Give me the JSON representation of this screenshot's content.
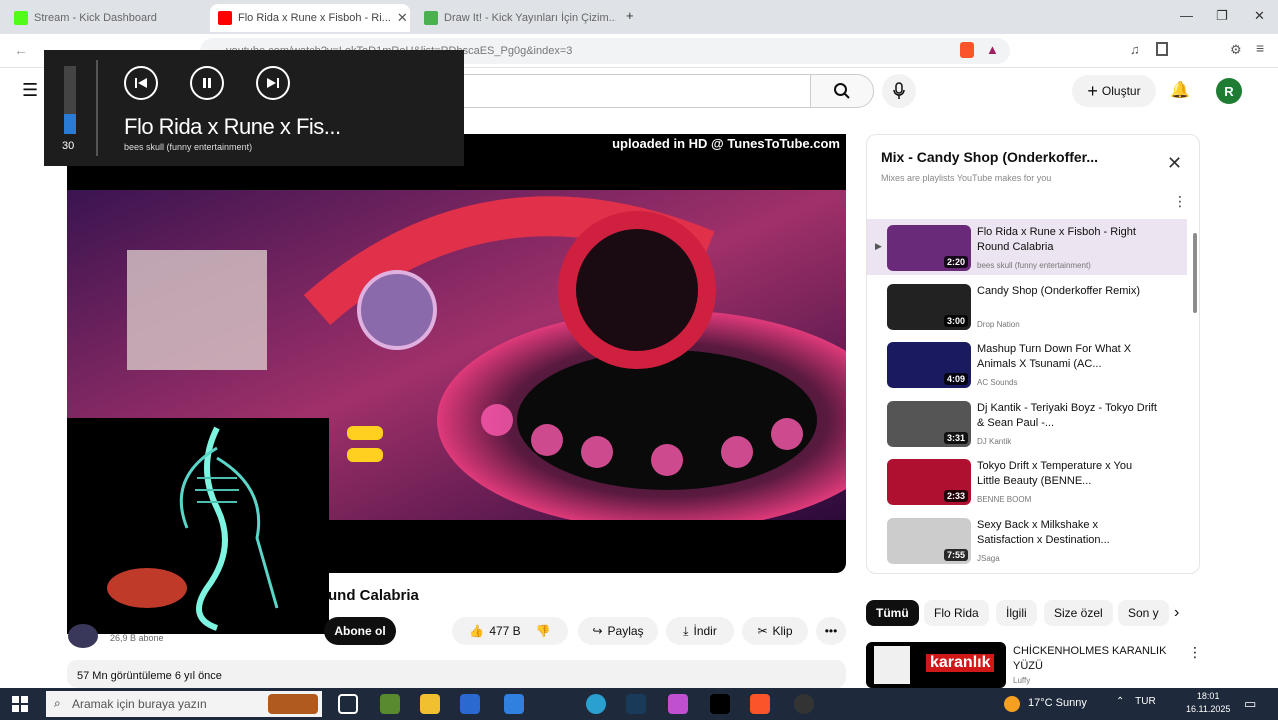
{
  "browser": {
    "tabs": [
      {
        "label": "Stream - Kick Dashboard",
        "active": false,
        "favicon_color": "#53fc18"
      },
      {
        "label": "Flo Rida x Rune x Fisboh - Ri...",
        "active": true,
        "favicon_color": "#ff0000"
      },
      {
        "label": "Draw It! - Kick Yayınları İçin Çizim...",
        "active": false,
        "favicon_color": "#4caf50"
      }
    ],
    "new_tab": "+",
    "url": "youtube.com/watch?v=LokToD1mRoU&list=RDhscaES_Pg0g&index=3",
    "window_controls": [
      "—",
      "❐",
      "✕"
    ]
  },
  "media_overlay": {
    "volume": "30",
    "volume_fraction": 0.3,
    "title": "Flo Rida x  Rune x Fis...",
    "artist": "bees skull (funny entertainment)"
  },
  "youtube": {
    "header": {
      "create_label": "Oluştur",
      "avatar_letter": "R"
    },
    "video": {
      "overlay_text": "uploaded in HD @ TunesToTube.com",
      "title_visible": "und Calabria",
      "subscribers": "26,9 B abone",
      "subscribe_label": "Abone ol",
      "likes": "477 B",
      "share_label": "Paylaş",
      "download_label": "İndir",
      "clip_label": "Klip",
      "views_date": "57 Mn görüntüleme  6 yıl önce"
    },
    "playlist": {
      "title": "Mix - Candy Shop (Onderkoffer...",
      "subtitle": "Mixes are playlists YouTube makes for you",
      "items": [
        {
          "title": "Flo Rida x Rune x Fisboh - Right Round Calabria",
          "channel": "bees skull (funny entertainment)",
          "duration": "2:20",
          "current": true,
          "thumb": "#6a2a7a"
        },
        {
          "title": "Candy Shop (Onderkoffer Remix)",
          "channel": "Drop Nation",
          "duration": "3:00",
          "current": false,
          "thumb": "#222222"
        },
        {
          "title": "Mashup Turn Down For What X Animals X Tsunami (AC...",
          "channel": "AC Sounds",
          "duration": "4:09",
          "current": false,
          "thumb": "#1a1a60"
        },
        {
          "title": "Dj Kantik - Teriyaki Boyz - Tokyo Drift & Sean Paul -...",
          "channel": "DJ Kantik",
          "duration": "3:31",
          "current": false,
          "thumb": "#555555"
        },
        {
          "title": "Tokyo Drift x Temperature x You Little Beauty (BENNE...",
          "channel": "BENNE BOOM",
          "duration": "2:33",
          "current": false,
          "thumb": "#b01030"
        },
        {
          "title": "Sexy Back x Milkshake x Satisfaction x Destination...",
          "channel": "JSaga",
          "duration": "7:55",
          "current": false,
          "thumb": "#cccccc"
        }
      ]
    },
    "chips": [
      {
        "label": "Tümü",
        "selected": true
      },
      {
        "label": "Flo Rida",
        "selected": false
      },
      {
        "label": "İlgili",
        "selected": false
      },
      {
        "label": "Size özel",
        "selected": false
      },
      {
        "label": "Son y",
        "selected": false
      }
    ],
    "related": {
      "title": "CHİCKENHOLMES KARANLIK YÜZÜ",
      "channel": "Luffy",
      "thumb_text": "karanlık"
    }
  },
  "taskbar": {
    "search_placeholder": "Aramak için buraya yazın",
    "weather": "17°C  Sunny",
    "lang": "TUR",
    "time": "18:01",
    "date": "16.11.2025"
  }
}
